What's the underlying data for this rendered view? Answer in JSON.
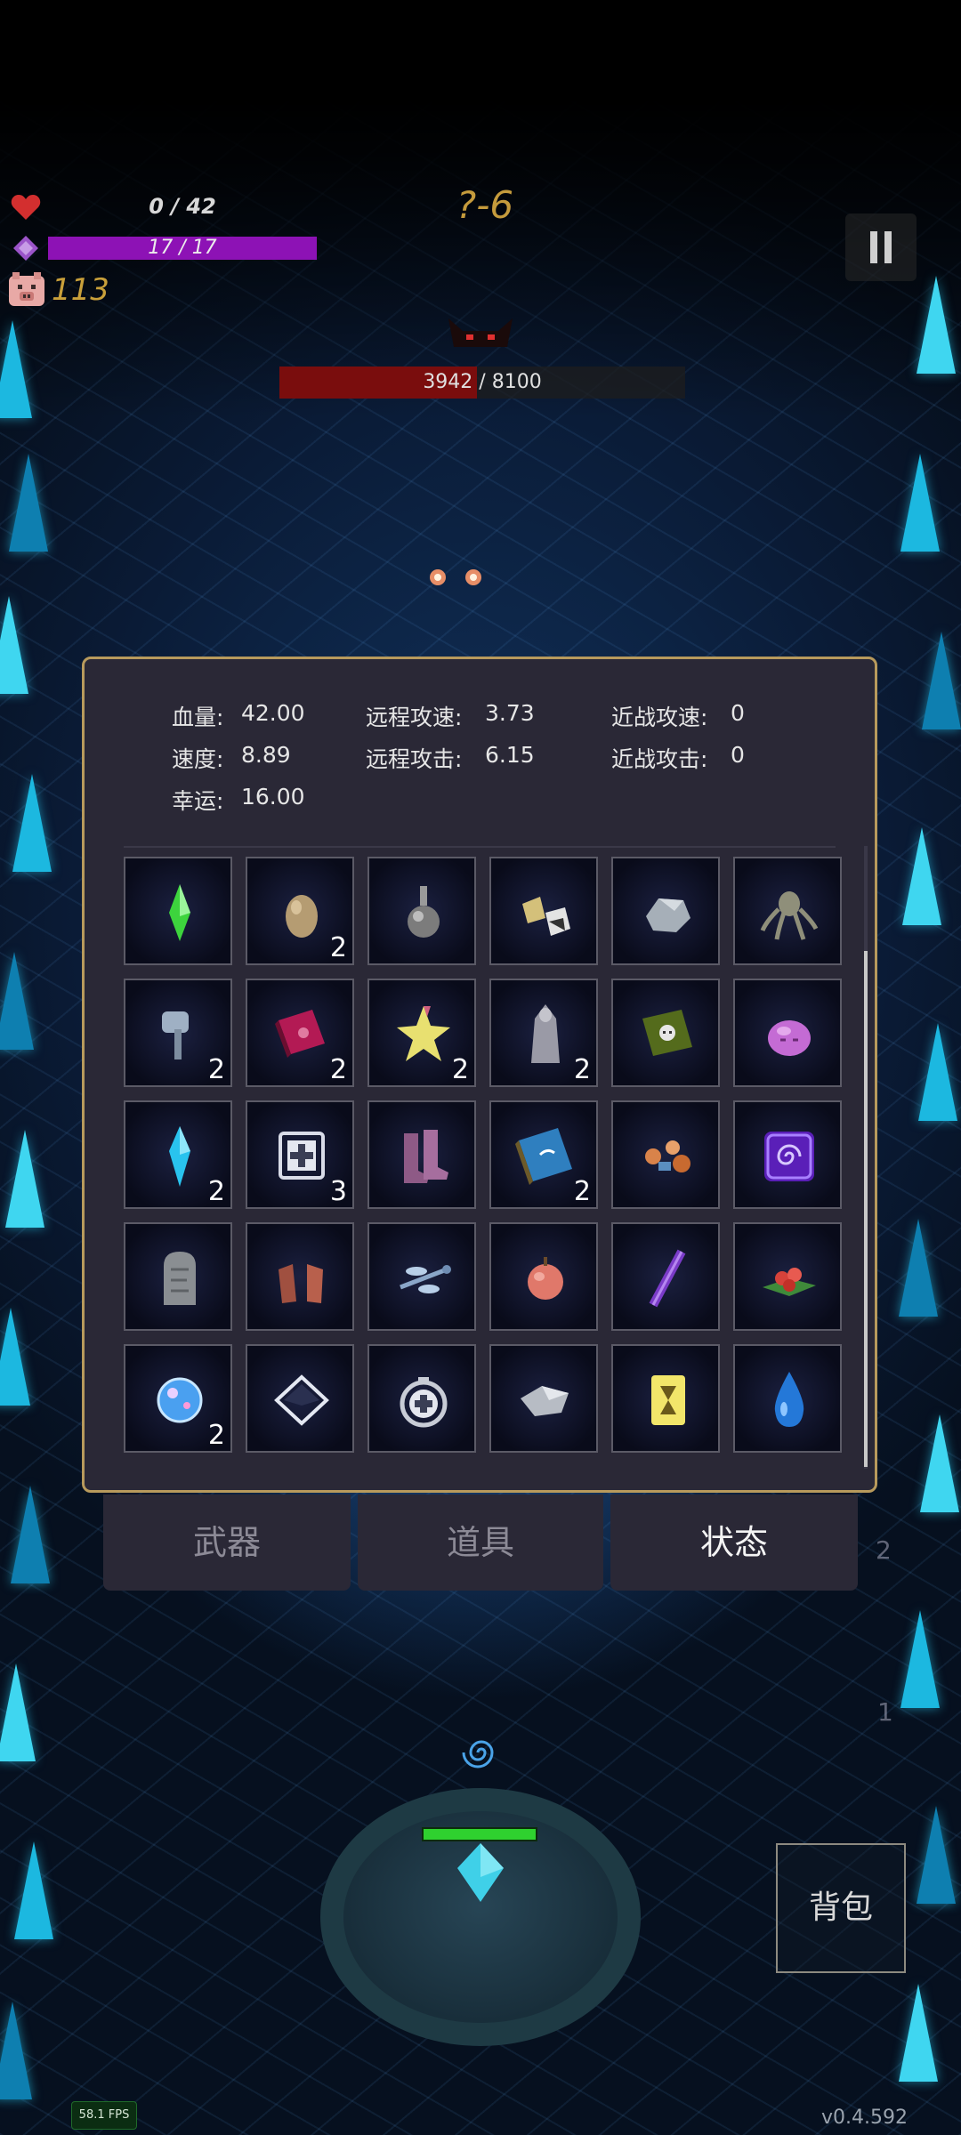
{
  "hud": {
    "hp": "0 / 42",
    "mana": "17 / 17",
    "mana_fraction": 1.0,
    "coins": "113",
    "stage": "?-6",
    "boss_hp": "3942 / 8100",
    "boss_hp_fraction": 0.487
  },
  "stats": {
    "hp_label": "血量:",
    "hp_value": "42.00",
    "speed_label": "速度:",
    "speed_value": "8.89",
    "luck_label": "幸运:",
    "luck_value": "16.00",
    "ranged_speed_label": "远程攻速:",
    "ranged_speed_value": "3.73",
    "ranged_attack_label": "远程攻击:",
    "ranged_attack_value": "6.15",
    "melee_speed_label": "近战攻速:",
    "melee_speed_value": "0",
    "melee_attack_label": "近战攻击:",
    "melee_attack_value": "0"
  },
  "items": [
    {
      "icon": "green-crystal-icon",
      "count": ""
    },
    {
      "icon": "egg-icon",
      "count": "2"
    },
    {
      "icon": "potion-flask-icon",
      "count": ""
    },
    {
      "icon": "ore-chunks-icon",
      "count": ""
    },
    {
      "icon": "stone-icon",
      "count": ""
    },
    {
      "icon": "octopus-icon",
      "count": ""
    },
    {
      "icon": "hammer-icon",
      "count": "2"
    },
    {
      "icon": "red-book-icon",
      "count": "2"
    },
    {
      "icon": "star-crystal-icon",
      "count": "2"
    },
    {
      "icon": "statue-icon",
      "count": "2"
    },
    {
      "icon": "skull-book-icon",
      "count": ""
    },
    {
      "icon": "slime-icon",
      "count": ""
    },
    {
      "icon": "blue-crystal-icon",
      "count": "2"
    },
    {
      "icon": "medkit-icon",
      "count": "3"
    },
    {
      "icon": "boots-icon",
      "count": ""
    },
    {
      "icon": "blue-book-icon",
      "count": "2"
    },
    {
      "icon": "flowers-icon",
      "count": ""
    },
    {
      "icon": "portal-rune-icon",
      "count": ""
    },
    {
      "icon": "tombstone-icon",
      "count": ""
    },
    {
      "icon": "gloves-icon",
      "count": ""
    },
    {
      "icon": "dragonfly-icon",
      "count": ""
    },
    {
      "icon": "apple-icon",
      "count": ""
    },
    {
      "icon": "wand-icon",
      "count": ""
    },
    {
      "icon": "red-flower-icon",
      "count": ""
    },
    {
      "icon": "orb-icon",
      "count": "2"
    },
    {
      "icon": "diamond-plate-icon",
      "count": ""
    },
    {
      "icon": "health-ring-icon",
      "count": ""
    },
    {
      "icon": "silver-ore-icon",
      "count": ""
    },
    {
      "icon": "yellow-card-icon",
      "count": ""
    },
    {
      "icon": "water-drop-icon",
      "count": ""
    }
  ],
  "tabs": [
    {
      "label": "武器",
      "active": false
    },
    {
      "label": "道具",
      "active": false
    },
    {
      "label": "状态",
      "active": true
    }
  ],
  "side_counts": {
    "first": "2",
    "second": "1"
  },
  "backpack_label": "背包",
  "fps": "58.1 FPS",
  "version": "v0.4.592",
  "colors": {
    "panel_border": "#b89a5c",
    "mana": "#8d12b5",
    "boss_hp": "#7a0d0d",
    "coin": "#c9a03a"
  }
}
